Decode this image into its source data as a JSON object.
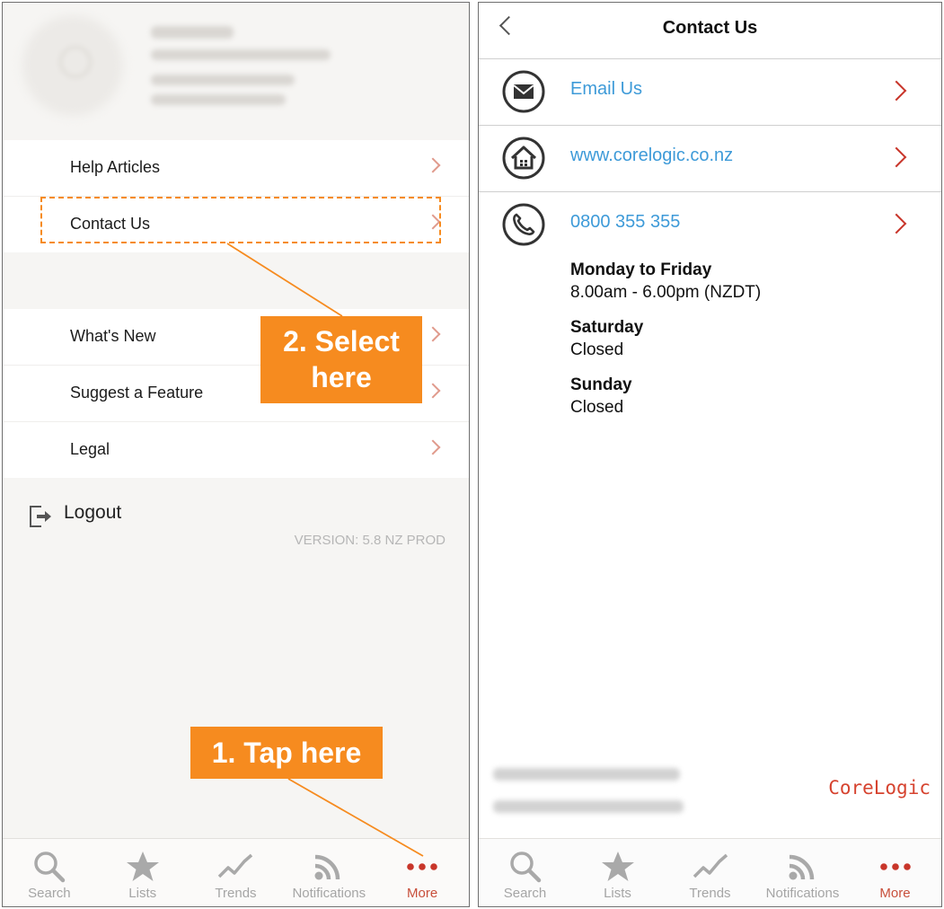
{
  "left": {
    "menu_top": [
      {
        "label": "Help Articles"
      },
      {
        "label": "Contact Us"
      }
    ],
    "menu_bottom": [
      {
        "label": "What's New"
      },
      {
        "label": "Suggest a Feature"
      },
      {
        "label": "Legal"
      }
    ],
    "logout_label": "Logout",
    "version": "VERSION: 5.8 NZ PROD",
    "tabs": [
      {
        "label": "Search",
        "icon": "search-icon"
      },
      {
        "label": "Lists",
        "icon": "star-icon"
      },
      {
        "label": "Trends",
        "icon": "trend-icon"
      },
      {
        "label": "Notifications",
        "icon": "rss-icon"
      },
      {
        "label": "More",
        "icon": "more-icon"
      }
    ],
    "callouts": {
      "select": "2. Select here",
      "tap": "1. Tap here"
    }
  },
  "right": {
    "title": "Contact Us",
    "email_label": "Email Us",
    "website_label": "www.corelogic.co.nz",
    "phone_label": "0800 355 355",
    "hours": [
      {
        "day": "Monday to Friday",
        "time": "8.00am - 6.00pm (NZDT)"
      },
      {
        "day": "Saturday",
        "time": "Closed"
      },
      {
        "day": "Sunday",
        "time": "Closed"
      }
    ],
    "brand": "CoreLogic",
    "tabs": [
      {
        "label": "Search",
        "icon": "search-icon"
      },
      {
        "label": "Lists",
        "icon": "star-icon"
      },
      {
        "label": "Trends",
        "icon": "trend-icon"
      },
      {
        "label": "Notifications",
        "icon": "rss-icon"
      },
      {
        "label": "More",
        "icon": "more-icon"
      }
    ]
  },
  "colors": {
    "accent": "#c84f3b",
    "link": "#3d9ad8",
    "callout": "#f68b1f",
    "brand": "#d6432f"
  }
}
